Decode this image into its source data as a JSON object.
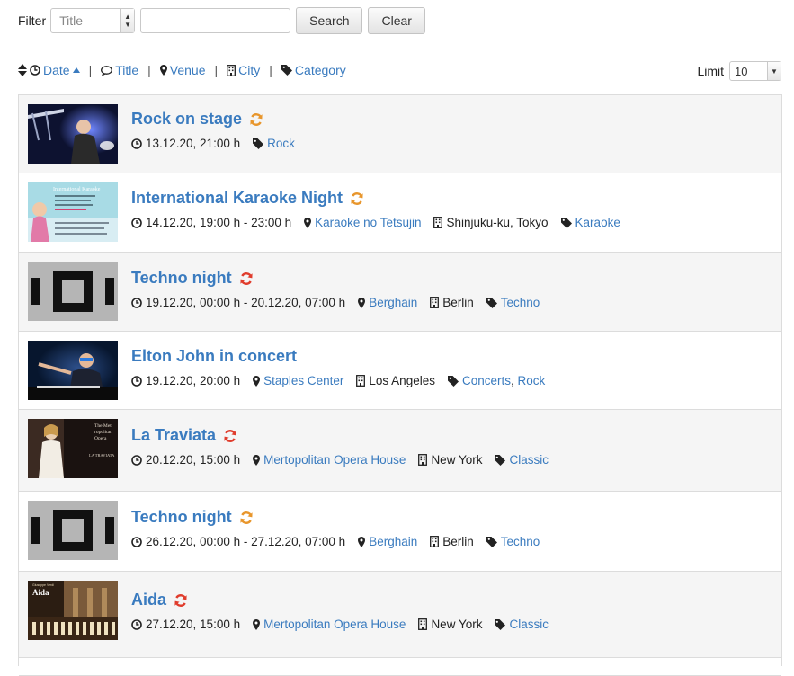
{
  "filter": {
    "label": "Filter",
    "field_select": "Title",
    "search_value": "",
    "search_button": "Search",
    "clear_button": "Clear"
  },
  "sort": {
    "date": "Date",
    "title": "Title",
    "venue": "Venue",
    "city": "City",
    "category": "Category",
    "separator": "|"
  },
  "limit": {
    "label": "Limit",
    "value": "10"
  },
  "colors": {
    "link": "#3a7bbf",
    "refresh_orange": "#e8962c",
    "refresh_red": "#e03c2c"
  },
  "events": [
    {
      "title": "Rock on stage",
      "refresh": "orange",
      "date": "13.12.20, 21:00 h",
      "venue": "",
      "city": "",
      "categories": [
        "Rock"
      ],
      "thumb": "concert-photo"
    },
    {
      "title": "International Karaoke Night",
      "refresh": "orange",
      "date": "14.12.20, 19:00 h - 23:00 h",
      "venue": "Karaoke no Tetsujin",
      "city": "Shinjuku-ku, Tokyo",
      "categories": [
        "Karaoke"
      ],
      "thumb": "karaoke-flyer"
    },
    {
      "title": "Techno night",
      "refresh": "red",
      "date": "19.12.20, 00:00 h - 20.12.20, 07:00 h",
      "venue": "Berghain",
      "city": "Berlin",
      "categories": [
        "Techno"
      ],
      "thumb": "techno-logo"
    },
    {
      "title": "Elton John in concert",
      "refresh": "",
      "date": "19.12.20, 20:00 h",
      "venue": "Staples Center",
      "city": "Los Angeles",
      "categories": [
        "Concerts",
        "Rock"
      ],
      "thumb": "piano-photo"
    },
    {
      "title": "La Traviata",
      "refresh": "red",
      "date": "20.12.20, 15:00 h",
      "venue": "Mertopolitan Opera House",
      "city": "New York",
      "categories": [
        "Classic"
      ],
      "thumb": "opera-poster"
    },
    {
      "title": "Techno night",
      "refresh": "orange",
      "date": "26.12.20, 00:00 h - 27.12.20, 07:00 h",
      "venue": "Berghain",
      "city": "Berlin",
      "categories": [
        "Techno"
      ],
      "thumb": "techno-logo"
    },
    {
      "title": "Aida",
      "refresh": "red",
      "date": "27.12.20, 15:00 h",
      "venue": "Mertopolitan Opera House",
      "city": "New York",
      "categories": [
        "Classic"
      ],
      "thumb": "aida-poster"
    }
  ],
  "thumb_text": {
    "karaoke_title": "International Karaoke",
    "opera_line1": "The Met",
    "opera_line2": "ropolitan",
    "opera_line3": "Opera",
    "opera_line4": "LA TRAVIATA",
    "aida_small": "Giuseppe Verdi",
    "aida_title": "Aida"
  }
}
